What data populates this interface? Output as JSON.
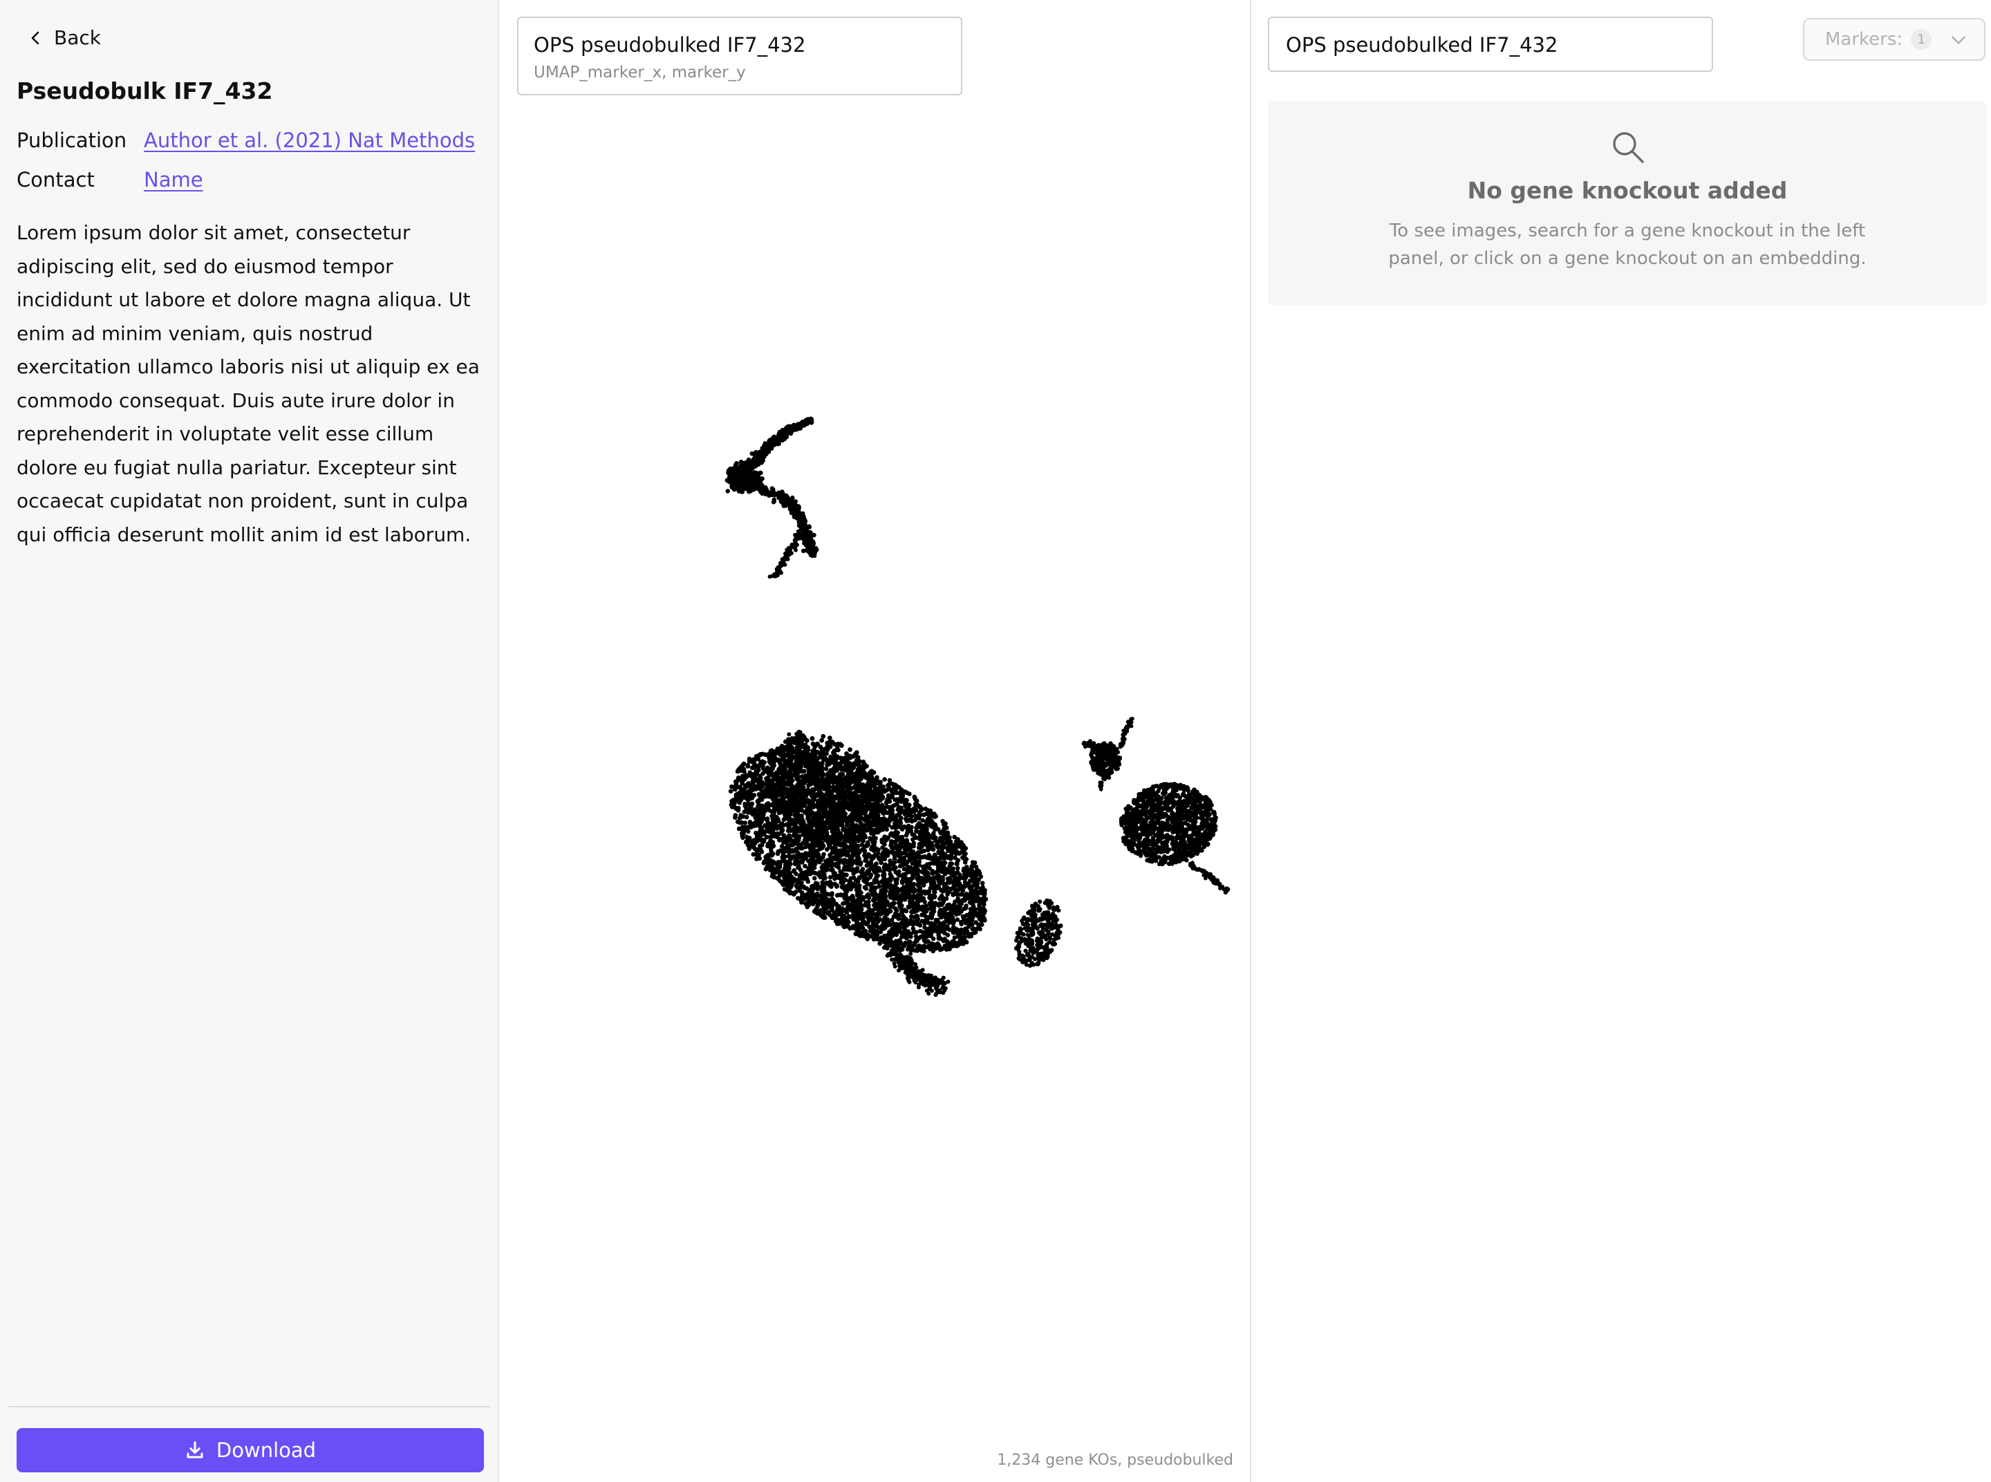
{
  "left_panel": {
    "back_label": "Back",
    "title": "Pseudobulk IF7_432",
    "publication_key": "Publication",
    "publication_value": "Author et al. (2021) Nat Methods",
    "contact_key": "Contact",
    "contact_value": "Name",
    "description": "Lorem ipsum dolor sit amet, consectetur adipiscing elit, sed do eiusmod tempor incididunt ut labore et dolore magna aliqua. Ut enim ad minim veniam, quis nostrud exercitation ullamco laboris nisi ut aliquip ex ea commodo consequat. Duis aute irure dolor in reprehenderit in voluptate velit esse cillum dolore eu fugiat nulla pariatur. Excepteur sint occaecat cupidatat non proident, sunt in culpa qui officia deserunt mollit anim id est laborum.",
    "download_label": "Download"
  },
  "middle_panel": {
    "embedding_title": "OPS pseudobulked IF7_432",
    "embedding_subtitle": "UMAP_marker_x, marker_y",
    "footnote": "1,234 gene KOs, pseudobulked",
    "point_color": "#000000"
  },
  "right_panel": {
    "select_title": "OPS pseudobulked IF7_432",
    "markers_label": "Markers:",
    "markers_count": "1",
    "empty_title": "No gene knockout added",
    "empty_text": "To see images, search for a gene knockout in the left panel, or click on a gene knockout on an embedding."
  },
  "colors": {
    "accent": "#6b4ef6",
    "link": "#6a4fe6",
    "panel_bg": "#f7f7f7"
  },
  "icons": {
    "back": "chevron-left-icon",
    "download": "download-icon",
    "markers": "chevron-down-icon",
    "empty": "search-icon"
  }
}
